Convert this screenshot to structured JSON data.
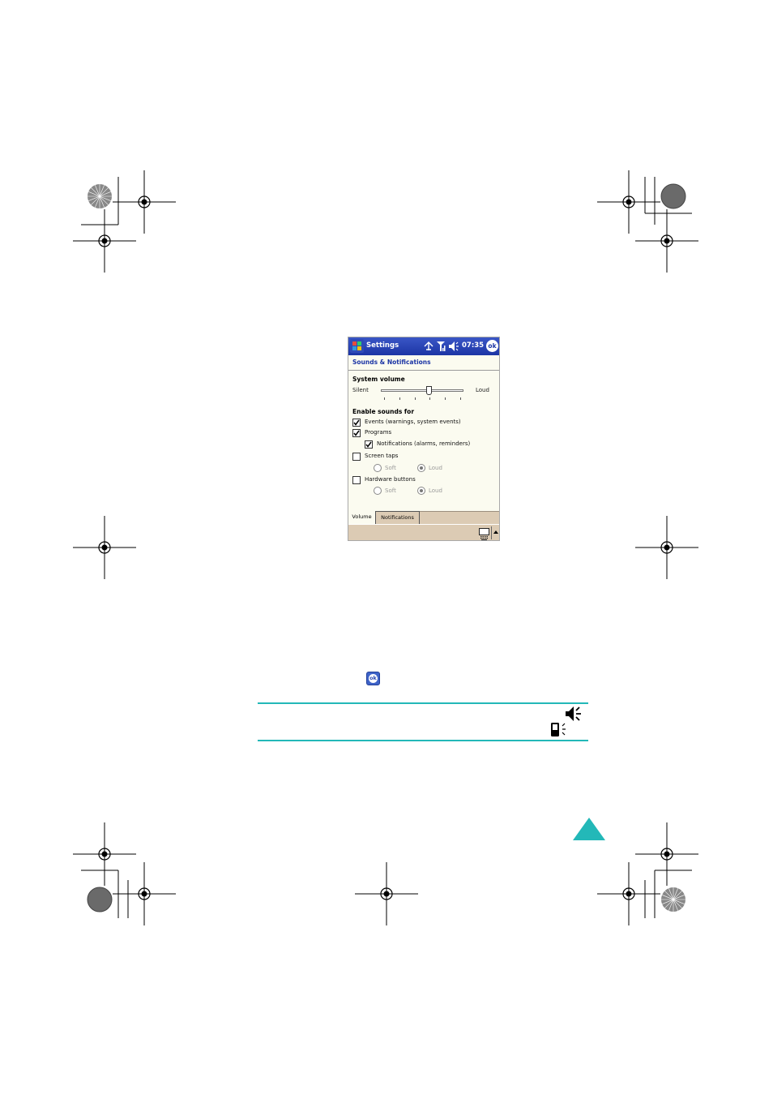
{
  "pda": {
    "title": "Settings",
    "time": "07:35",
    "ok_label": "ok",
    "page_title": "Sounds & Notifications",
    "system_volume_label": "System volume",
    "slider": {
      "min_label": "Silent",
      "max_label": "Loud",
      "value": 0.58,
      "tick_count": 6
    },
    "enable_sounds_label": "Enable sounds for",
    "options": {
      "events": {
        "label": "Events (warnings, system events)",
        "checked": true
      },
      "programs": {
        "label": "Programs",
        "checked": true
      },
      "notifications": {
        "label": "Notifications (alarms, reminders)",
        "checked": true
      },
      "screen_taps": {
        "label": "Screen taps",
        "checked": false
      },
      "hardware_buttons": {
        "label": "Hardware buttons",
        "checked": false
      }
    },
    "screen_taps_radios": {
      "soft": "Soft",
      "loud": "Loud",
      "selected": "Loud"
    },
    "hardware_radios": {
      "soft": "Soft",
      "loud": "Loud",
      "selected": "Loud"
    },
    "tabs": [
      "Volume",
      "Notifications"
    ],
    "active_tab": "Volume",
    "colors": {
      "titlebar": "#1c35a5",
      "panel": "#fbfbf0",
      "menubar": "#dccbb4"
    }
  },
  "page": {
    "inline_ok_label": "ok",
    "note_icons": [
      "speaker-icon",
      "phone-vibrate-icon"
    ],
    "accent_color": "#23b8b8",
    "next_arrow": "next-page-arrow"
  }
}
